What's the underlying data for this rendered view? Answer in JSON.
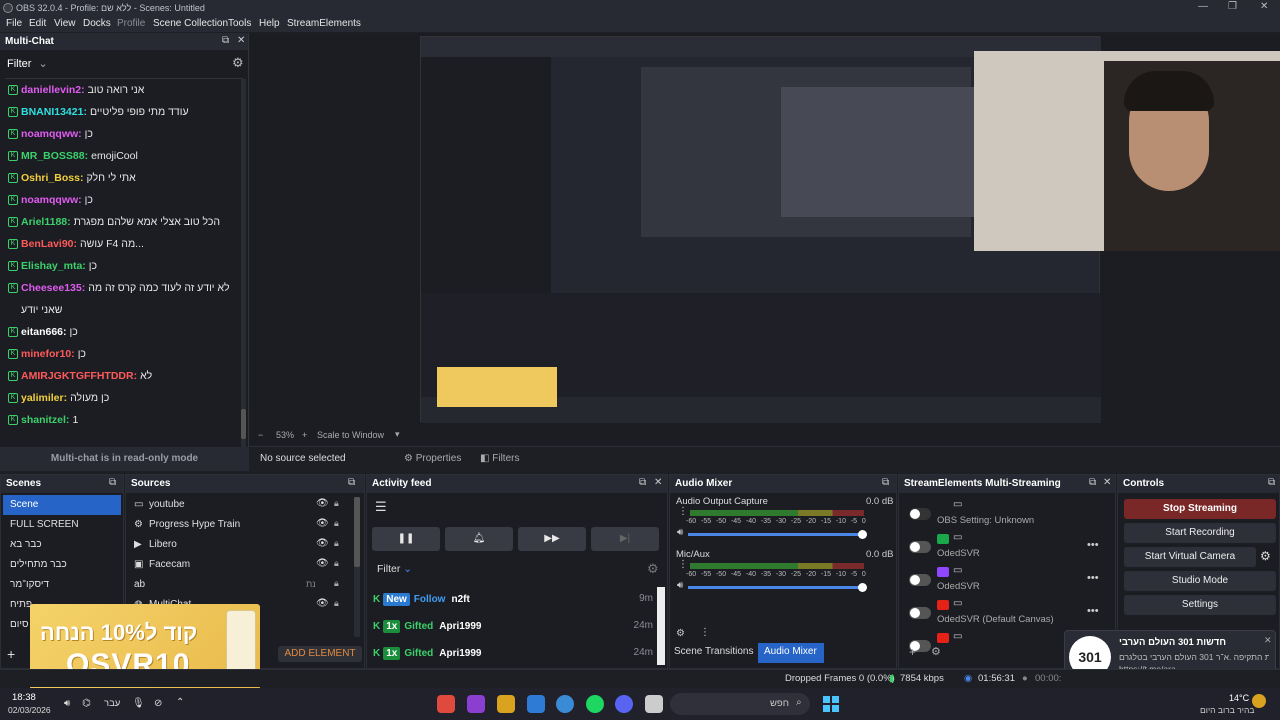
{
  "window": {
    "title": "OBS 32.0.4 - Profile: ללא שם - Scenes: Untitled"
  },
  "menu": {
    "file": "File",
    "edit": "Edit",
    "view": "View",
    "docks": "Docks",
    "profile": "Profile",
    "scene_collection": "Scene Collection",
    "tools": "Tools",
    "help": "Help",
    "streamelements": "StreamElements"
  },
  "multichat": {
    "title": "Multi-Chat",
    "filter_label": "Filter",
    "readonly": "Multi-chat is in read-only mode",
    "messages": [
      {
        "user": "daniellevin2:",
        "text": "אני רואה טוב",
        "color": "#e05cf0"
      },
      {
        "user": "BNANI13421:",
        "text": "עודד מתי פופי פליטיים",
        "color": "#2ee0e0"
      },
      {
        "user": "noamqqww:",
        "text": "כן",
        "color": "#e05cf0"
      },
      {
        "user": "MR_BOSS88:",
        "text": "emojiCool",
        "color": "#3bd16b"
      },
      {
        "user": "Oshri_Boss:",
        "text": "אתי לי חלק",
        "color": "#f2d03c"
      },
      {
        "user": "noamqqww:",
        "text": "כן",
        "color": "#e05cf0"
      },
      {
        "user": "Ariel1188:",
        "text": "הכל טוב אצלי אמא שלהם מפגרת",
        "color": "#3bd16b"
      },
      {
        "user": "BenLavi90:",
        "text": "עושה F4 מה...",
        "color": "#ff5a5a"
      },
      {
        "user": "Elishay_mta:",
        "text": "כן",
        "color": "#3bd16b"
      },
      {
        "user": "Cheesee135:",
        "text": "לא יודע זה לעוד כמה קרס זה מה",
        "color": "#e05cf0",
        "extra": "שאני יודע"
      },
      {
        "user": "eitan666:",
        "text": "כן",
        "color": "#ffffff"
      },
      {
        "user": "minefor10:",
        "text": "כן",
        "color": "#ff5a5a"
      },
      {
        "user": "AMIRJGKTGFFHTDDR:",
        "text": "לא",
        "color": "#ff5a5a"
      },
      {
        "user": "yalimiler:",
        "text": "כן מעולה",
        "color": "#f2d03c"
      },
      {
        "user": "shanitzel:",
        "text": "1",
        "color": "#3bd16b"
      }
    ]
  },
  "preview": {
    "zoom": "53%",
    "scale_label": "Scale to Window",
    "no_source": "No source selected",
    "properties": "Properties",
    "filters": "Filters"
  },
  "scenes": {
    "title": "Scenes",
    "items": [
      "Scene",
      "FULL SCREEN",
      "כבר בא",
      "כבר מתחילים",
      "דיסקו־מר",
      "פתיח",
      "כבר סיום"
    ]
  },
  "sources": {
    "title": "Sources",
    "items": [
      {
        "name": "youtube",
        "icon": "window-icon"
      },
      {
        "name": "Progress Hype Train",
        "icon": "gear-icon"
      },
      {
        "name": "Libero",
        "icon": "play-icon"
      },
      {
        "name": "Facecam",
        "icon": "camera-icon"
      },
      {
        "name": "ab",
        "icon": "text-icon"
      },
      {
        "name": "MultiChat",
        "icon": "globe-icon"
      }
    ],
    "add_element": "ADD ELEMENT",
    "ab_label": "נת"
  },
  "promo": {
    "line1": "קוד ל10% הנחה",
    "line2": "OSVR10"
  },
  "activity": {
    "title": "Activity feed",
    "filter": "Filter",
    "rows": [
      {
        "badge": "New",
        "action": "Follow",
        "user": "n2ft",
        "time": "9m"
      },
      {
        "badge": "1x",
        "action": "Gifted",
        "user": "Apri1999",
        "time": "24m"
      },
      {
        "badge": "1x",
        "action": "Gifted",
        "user": "Apri1999",
        "time": "24m"
      }
    ]
  },
  "audio": {
    "title": "Audio Mixer",
    "channels": [
      {
        "name": "Audio Output Capture",
        "db": "0.0 dB"
      },
      {
        "name": "Mic/Aux",
        "db": "0.0 dB"
      }
    ],
    "ticks": [
      "-60",
      "-55",
      "-50",
      "-45",
      "-40",
      "-35",
      "-30",
      "-25",
      "-20",
      "-15",
      "-10",
      "-5",
      "0"
    ],
    "tab_transitions": "Scene Transitions",
    "tab_mixer": "Audio Mixer"
  },
  "multistream": {
    "title": "StreamElements Multi-Streaming",
    "rows": [
      {
        "name": "OBS Setting: Unknown",
        "color": "#777"
      },
      {
        "name": "OdedSVR",
        "color": "#1ba84a"
      },
      {
        "name": "OdedSVR",
        "color": "#9146ff"
      },
      {
        "name": "OdedSVR (Default Canvas)",
        "color": "#e62117"
      },
      {
        "name": "",
        "color": "#e62117"
      }
    ]
  },
  "controls": {
    "title": "Controls",
    "stop_streaming": "Stop Streaming",
    "start_recording": "Start Recording",
    "start_virtual_camera": "Start Virtual Camera",
    "studio_mode": "Studio Mode",
    "settings": "Settings"
  },
  "statusbar": {
    "dropped": "Dropped Frames 0 (0.0%)",
    "bitrate": "7854 kbps",
    "stream_time": "01:56:31",
    "rec_time": "00:00:"
  },
  "notification": {
    "title": "חדשות 301 העולם הערבי",
    "body": "מדורת התקיפה .א־ר 301 העולם הערבי בטלגרם",
    "link": "https://t.me/ara..."
  },
  "taskbar": {
    "time": "18:38",
    "date": "02/03/2026",
    "lang": "עבר",
    "search": "חפש",
    "weather_temp": "14°C",
    "weather_text": "בהיר ברוב היום"
  }
}
